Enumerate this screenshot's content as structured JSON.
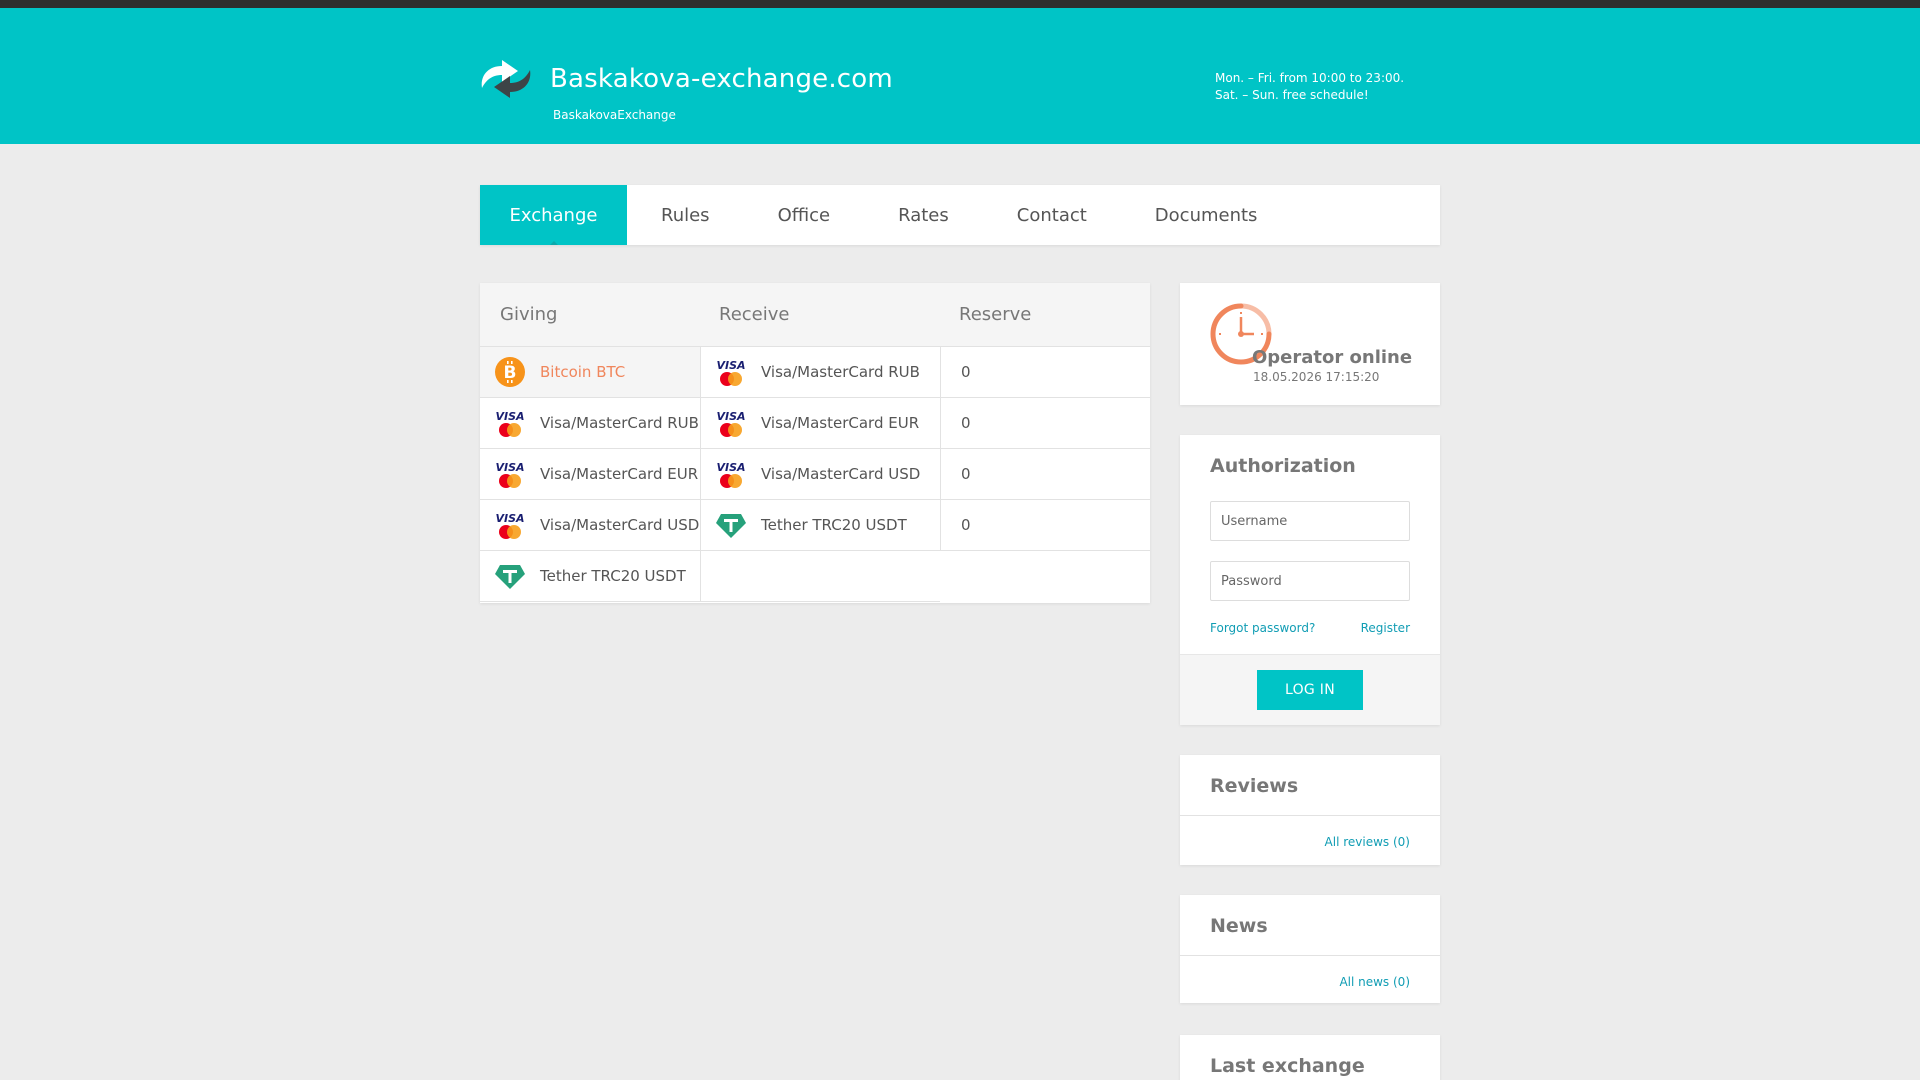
{
  "header": {
    "title": "Baskakova-exchange.com",
    "subtitle": "BaskakovaExchange",
    "hours_line1": "Mon. – Fri. from 10:00 to 23:00.",
    "hours_line2": "Sat. – Sun. free schedule!",
    "colors": {
      "accent": "#00c4c6",
      "top_bar": "#2e2e2e"
    }
  },
  "nav": {
    "items": [
      {
        "label": "Exchange",
        "active": true
      },
      {
        "label": "Rules"
      },
      {
        "label": "Office"
      },
      {
        "label": "Rates"
      },
      {
        "label": "Contact"
      },
      {
        "label": "Documents"
      }
    ]
  },
  "exchange": {
    "headers": {
      "giving": "Giving",
      "receive": "Receive",
      "reserve": "Reserve"
    },
    "giving": [
      {
        "label": "Bitcoin BTC",
        "icon": "bitcoin-icon",
        "selected": true
      },
      {
        "label": "Visa/MasterCard RUB",
        "icon": "visa-mastercard-icon"
      },
      {
        "label": "Visa/MasterCard EUR",
        "icon": "visa-mastercard-icon"
      },
      {
        "label": "Visa/MasterCard USD",
        "icon": "visa-mastercard-icon"
      },
      {
        "label": "Tether TRC20 USDT",
        "icon": "tether-icon"
      }
    ],
    "receive": [
      {
        "label": "Visa/MasterCard RUB",
        "icon": "visa-mastercard-icon",
        "reserve": "0"
      },
      {
        "label": "Visa/MasterCard EUR",
        "icon": "visa-mastercard-icon",
        "reserve": "0"
      },
      {
        "label": "Visa/MasterCard USD",
        "icon": "visa-mastercard-icon",
        "reserve": "0"
      },
      {
        "label": "Tether TRC20 USDT",
        "icon": "tether-icon",
        "reserve": "0"
      }
    ]
  },
  "operator": {
    "status": "Operator online",
    "datetime": "18.05.2026 17:15:20",
    "icon": "clock-icon"
  },
  "auth": {
    "title": "Authorization",
    "username_placeholder": "Username",
    "password_placeholder": "Password",
    "forgot": "Forgot password?",
    "register": "Register",
    "login": "LOG IN"
  },
  "reviews": {
    "title": "Reviews",
    "link": "All reviews (0)"
  },
  "news": {
    "title": "News",
    "link": "All news (0)"
  },
  "last_exchange": {
    "title": "Last exchange"
  }
}
